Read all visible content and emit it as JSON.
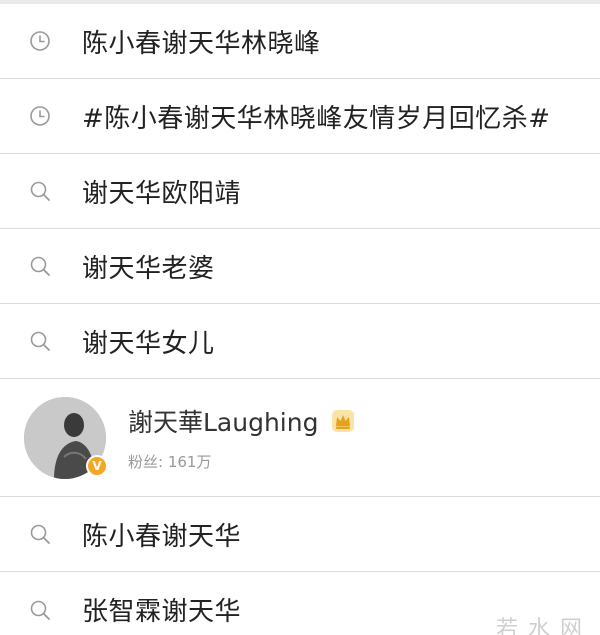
{
  "history": [
    {
      "icon": "clock-icon",
      "label": "陈小春谢天华林晓峰"
    },
    {
      "icon": "clock-icon",
      "label": "#陈小春谢天华林晓峰友情岁月回忆杀#"
    }
  ],
  "suggestions_top": [
    {
      "icon": "search-icon",
      "label": "谢天华欧阳靖"
    },
    {
      "icon": "search-icon",
      "label": "谢天华老婆"
    },
    {
      "icon": "search-icon",
      "label": "谢天华女儿"
    }
  ],
  "user": {
    "name": "謝天華Laughing",
    "fans": "粉丝: 161万",
    "verified_badge": "V",
    "badge_color": "#f5a623"
  },
  "suggestions_bottom": [
    {
      "icon": "search-icon",
      "label": "陈小春谢天华"
    },
    {
      "icon": "search-icon",
      "label": "张智霖谢天华"
    }
  ],
  "watermark": "若水网"
}
